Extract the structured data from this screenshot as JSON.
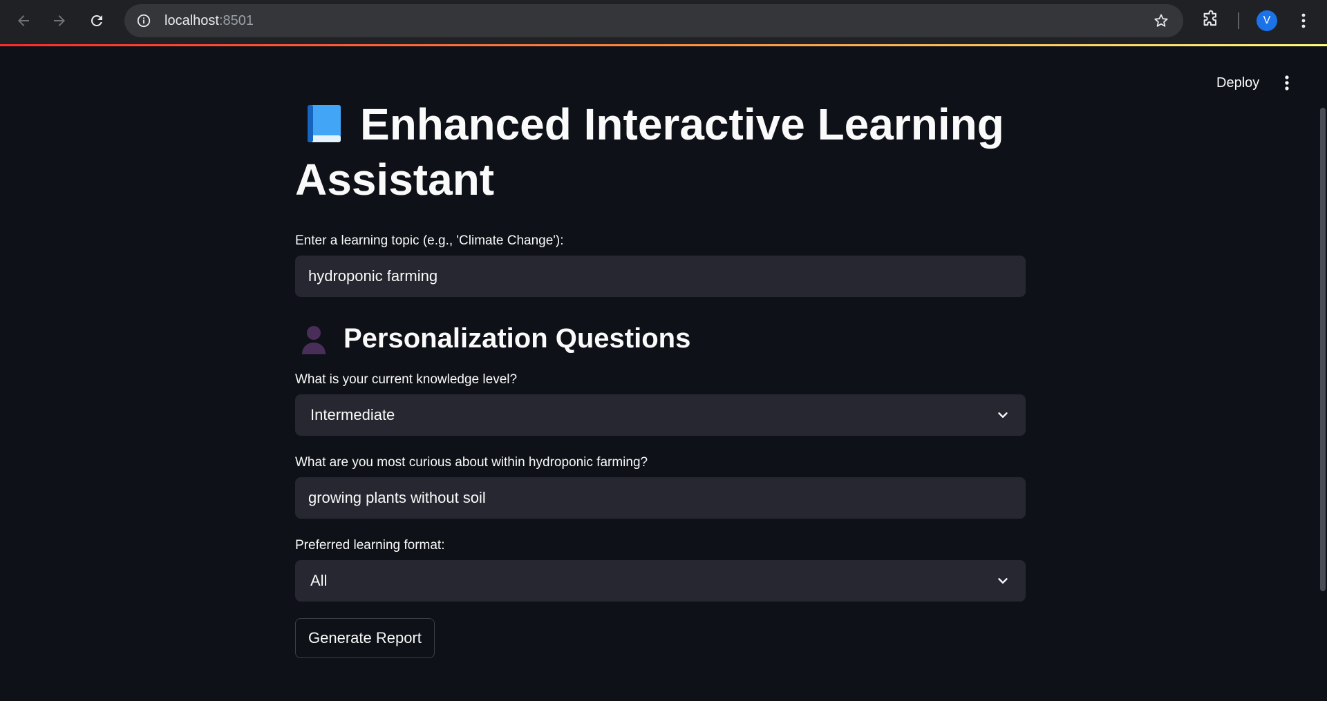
{
  "browser": {
    "url_host": "localhost",
    "url_port": ":8501",
    "profile_initial": "V"
  },
  "header": {
    "deploy_label": "Deploy"
  },
  "main": {
    "title": "Enhanced Interactive Learning Assistant",
    "topic": {
      "label": "Enter a learning topic (e.g., 'Climate Change'):",
      "value": "hydroponic farming"
    },
    "section_title": "Personalization Questions",
    "knowledge": {
      "label": "What is your current knowledge level?",
      "value": "Intermediate"
    },
    "curious": {
      "label": "What are you most curious about within hydroponic farming?",
      "value": "growing plants without soil"
    },
    "format": {
      "label": "Preferred learning format:",
      "value": "All"
    },
    "generate_label": "Generate Report"
  },
  "colors": {
    "background": "#0e1117",
    "input_bg": "#262730",
    "chrome_bg": "#202124",
    "accent_gradient_start": "#ff2b2b",
    "accent_gradient_end": "#fffd80"
  },
  "icons": [
    "back-arrow-icon",
    "forward-arrow-icon",
    "reload-icon",
    "site-info-icon",
    "star-icon",
    "extensions-icon",
    "chrome-menu-icon",
    "app-menu-icon",
    "book-icon",
    "person-icon",
    "chevron-down-icon"
  ]
}
